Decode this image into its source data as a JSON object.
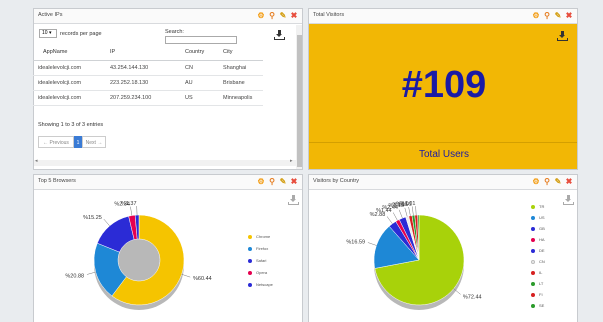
{
  "active_ips": {
    "title": "Active IPs",
    "page_length": "10",
    "page_length_suffix": "records per page",
    "search_label": "Search:",
    "search_value": "",
    "columns": [
      "AppName",
      "IP",
      "Country",
      "City"
    ],
    "rows": [
      [
        "idealelevolcji.com",
        "43.254.144.130",
        "CN",
        "Shanghai"
      ],
      [
        "idealelevolcji.com",
        "223.252.18.130",
        "AU",
        "Brisbane"
      ],
      [
        "idealelevolcji.com",
        "207.259.234.100",
        "US",
        "Minneapolis"
      ]
    ],
    "info": "Showing 1 to 3 of 3 entries",
    "prev_label": "← Previous",
    "page_num": "1",
    "next_label": "Next →"
  },
  "total_visitors": {
    "title": "Total Visitors",
    "value": "#109",
    "footer": "Total Users"
  },
  "top_browsers": {
    "title": "Top 5 Browsers",
    "chart_data": {
      "type": "pie",
      "labels": [
        "Chrome",
        "Firefox",
        "Safari",
        "Opera",
        "Netscape"
      ],
      "values": [
        60.44,
        20.88,
        15.25,
        2.34,
        1.37
      ],
      "value_labels": [
        "%60.44",
        "%20.88",
        "%15.25",
        "%2.34",
        "%1.37"
      ],
      "colors": [
        "#f5c400",
        "#1e88d6",
        "#2b2bd6",
        "#e5004f",
        "#2b2bd6"
      ]
    }
  },
  "visitors_by_country": {
    "title": "Visitors by Country",
    "chart_data": {
      "type": "pie",
      "labels": [
        "TR",
        "US",
        "GB",
        "HA",
        "DE",
        "CN",
        "IL",
        "LT",
        "FI",
        "SE"
      ],
      "values": [
        72.44,
        16.59,
        2.88,
        1.44,
        2.44,
        1.15,
        1.15,
        1.01,
        1.01,
        0.5
      ],
      "value_labels": [
        "%72.44",
        "%16.59",
        "%2.88",
        "%1.44",
        "%2.44",
        "%1.15",
        "%1.15",
        "%1.01",
        "%1.01",
        ""
      ],
      "colors": [
        "#a8d20a",
        "#1e88d6",
        "#2b2bd6",
        "#e5004f",
        "#2b2bd6",
        "#eeeeee",
        "#d62020",
        "#2b9b2b",
        "#d62020",
        "#2b9b2b"
      ]
    }
  }
}
